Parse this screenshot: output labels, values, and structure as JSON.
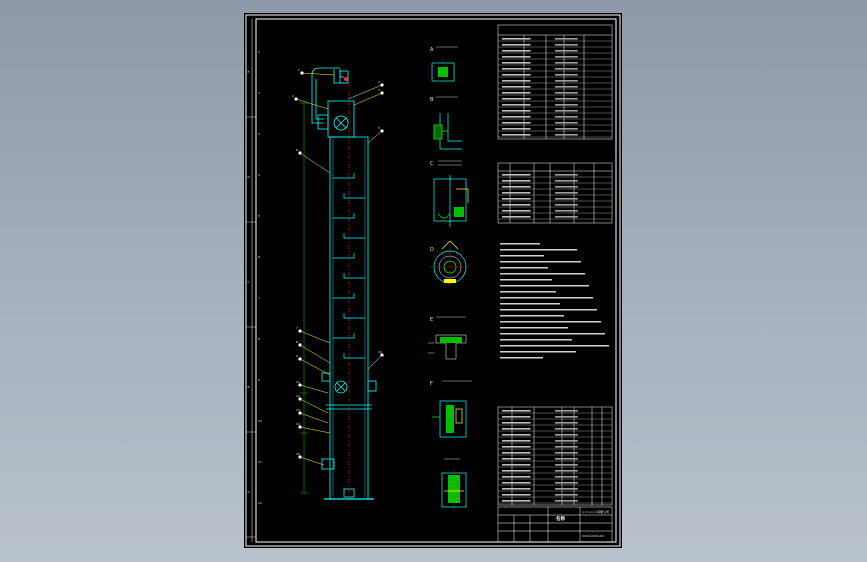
{
  "zone_letters": [
    "E",
    "D",
    "C",
    "B",
    "A"
  ],
  "zone_numbers": [
    "1",
    "2",
    "3",
    "4",
    "5",
    "6",
    "7",
    "8",
    "9",
    "10",
    "11",
    "12"
  ],
  "main_part_balloons": [
    "1",
    "2",
    "3",
    "4",
    "5",
    "6",
    "7",
    "8",
    "9",
    "10",
    "11",
    "12",
    "13",
    "14",
    "15"
  ],
  "detail_view_balloons": [
    "A",
    "B",
    "C",
    "D",
    "E",
    "F"
  ],
  "title_block": {
    "name_text": "名称",
    "company_text": "××××××有限公司",
    "drawing_no_text": "XXXX-XXXX-00"
  },
  "colors": {
    "background": "#8d99a8",
    "sheet": "#000000",
    "frame": "#ffffff",
    "equipment": "#00ffff",
    "leaders": "#ffff00",
    "centerline": "#ff3030",
    "annotation": "#00ff00",
    "hatch": "#00c000"
  }
}
